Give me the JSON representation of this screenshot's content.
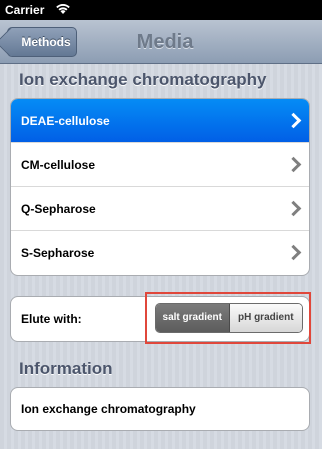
{
  "status_bar": {
    "carrier": "Carrier"
  },
  "nav": {
    "back_label": "Methods",
    "title": "Media"
  },
  "media_section": {
    "header": "Ion exchange chromatography",
    "items": [
      {
        "label": "DEAE-cellulose",
        "selected": true
      },
      {
        "label": "CM-cellulose",
        "selected": false
      },
      {
        "label": "Q-Sepharose",
        "selected": false
      },
      {
        "label": "S-Sepharose",
        "selected": false
      }
    ]
  },
  "elute": {
    "label": "Elute with:",
    "options": [
      "salt gradient",
      "pH gradient"
    ],
    "selected": "salt gradient"
  },
  "information": {
    "header": "Information",
    "text": "Ion exchange chromatography"
  },
  "colors": {
    "selected_row": "#0570f0",
    "highlight_border": "#e0473b",
    "section_header": "#4c566c"
  }
}
